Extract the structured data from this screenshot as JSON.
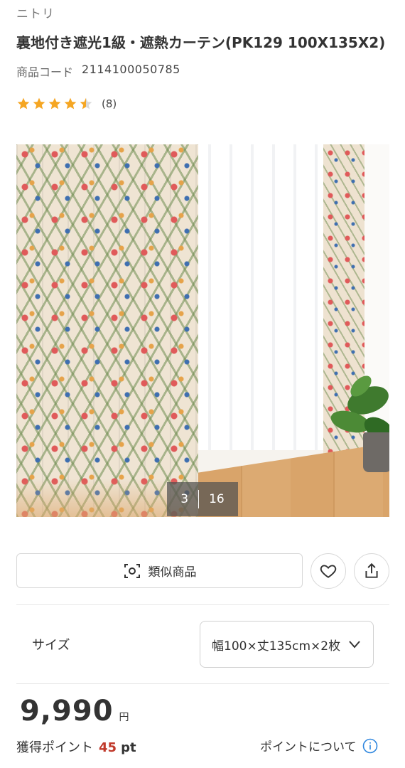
{
  "product": {
    "brand": "ニトリ",
    "title": "裏地付き遮光1級・遮熱カーテン(PK129 100X135X2)",
    "code_label": "商品コード",
    "code_value": "2114100050785"
  },
  "rating": {
    "stars": 4.5,
    "max": 5,
    "count_text": "(8)",
    "star_color": "#f5a623"
  },
  "gallery": {
    "current": "3",
    "total": "16"
  },
  "actions": {
    "similar_label": "類似商品",
    "favorite_icon": "heart-icon",
    "share_icon": "share-icon"
  },
  "size": {
    "label": "サイズ",
    "selected": "幅100×丈135cm×2枚"
  },
  "price": {
    "amount": "9,990",
    "unit": "円"
  },
  "points": {
    "label": "獲得ポイント",
    "value": "45",
    "unit": "pt",
    "link_label": "ポイントについて",
    "accent_color": "#c0392b",
    "info_color": "#2e86de"
  }
}
